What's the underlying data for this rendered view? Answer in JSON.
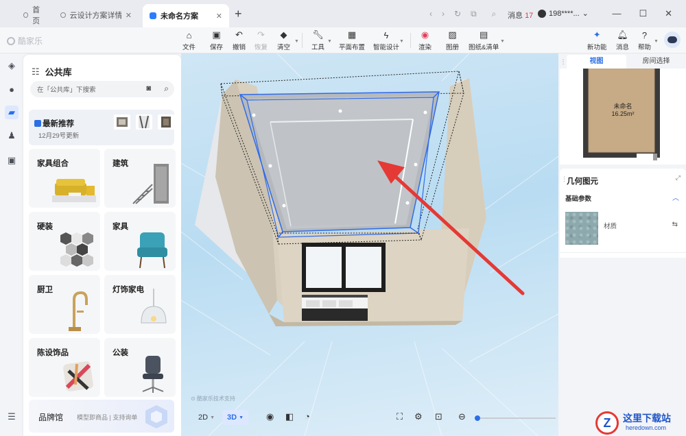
{
  "browser": {
    "tabs": [
      {
        "label": "首页"
      },
      {
        "label": "云设计方案详情 - 酷家..."
      },
      {
        "label": "未命名方案"
      }
    ],
    "messages_label": "消息",
    "messages_count": "17",
    "user": "198****..."
  },
  "app": {
    "logo": "酷家乐",
    "toolbar": [
      {
        "label": "文件",
        "icon": "home-icon"
      },
      {
        "label": "保存",
        "icon": "save-icon"
      },
      {
        "label": "撤销",
        "icon": "undo-icon"
      },
      {
        "label": "恢复",
        "icon": "redo-icon"
      },
      {
        "label": "清空",
        "icon": "eraser-icon"
      },
      {
        "label": "工具",
        "icon": "wrench-icon"
      },
      {
        "label": "平面布置",
        "icon": "layout-icon"
      },
      {
        "label": "智能设计",
        "icon": "lightning-icon"
      },
      {
        "label": "渲染",
        "icon": "render-icon"
      },
      {
        "label": "图册",
        "icon": "album-icon"
      },
      {
        "label": "图纸&清单",
        "icon": "drawing-icon"
      }
    ],
    "toolbar_right": [
      {
        "label": "新功能",
        "icon": "new-feature-icon"
      },
      {
        "label": "消息",
        "icon": "bell-icon"
      },
      {
        "label": "帮助",
        "icon": "help-icon"
      }
    ]
  },
  "library": {
    "title": "公共库",
    "search_placeholder": "在「公共库」下搜索",
    "recommend": {
      "title": "最新推荐",
      "date": "12月29号更新"
    },
    "categories": [
      {
        "label": "家具组合"
      },
      {
        "label": "建筑"
      },
      {
        "label": "硬装"
      },
      {
        "label": "家具"
      },
      {
        "label": "厨卫"
      },
      {
        "label": "灯饰家电"
      },
      {
        "label": "陈设饰品"
      },
      {
        "label": "公装"
      }
    ],
    "brand": {
      "title": "品牌馆",
      "subtitle": "模型即商品 | 支持询单"
    }
  },
  "viewport": {
    "watermark": "酷家乐技术支持",
    "view2d": "2D",
    "view3d": "3D"
  },
  "right_panel": {
    "tabs": [
      {
        "label": "视图"
      },
      {
        "label": "房间选择"
      }
    ],
    "room_name": "未命名",
    "room_area": "16.25m²",
    "geometry_title": "几何图元",
    "basic_params": "基础参数",
    "material_label": "材质"
  },
  "site_logo": {
    "title": "这里下载站",
    "url_text": "heredown.com"
  },
  "colors": {
    "accent": "#2b6fe6",
    "arrow": "#e53935",
    "selection": "#2f6be8"
  }
}
